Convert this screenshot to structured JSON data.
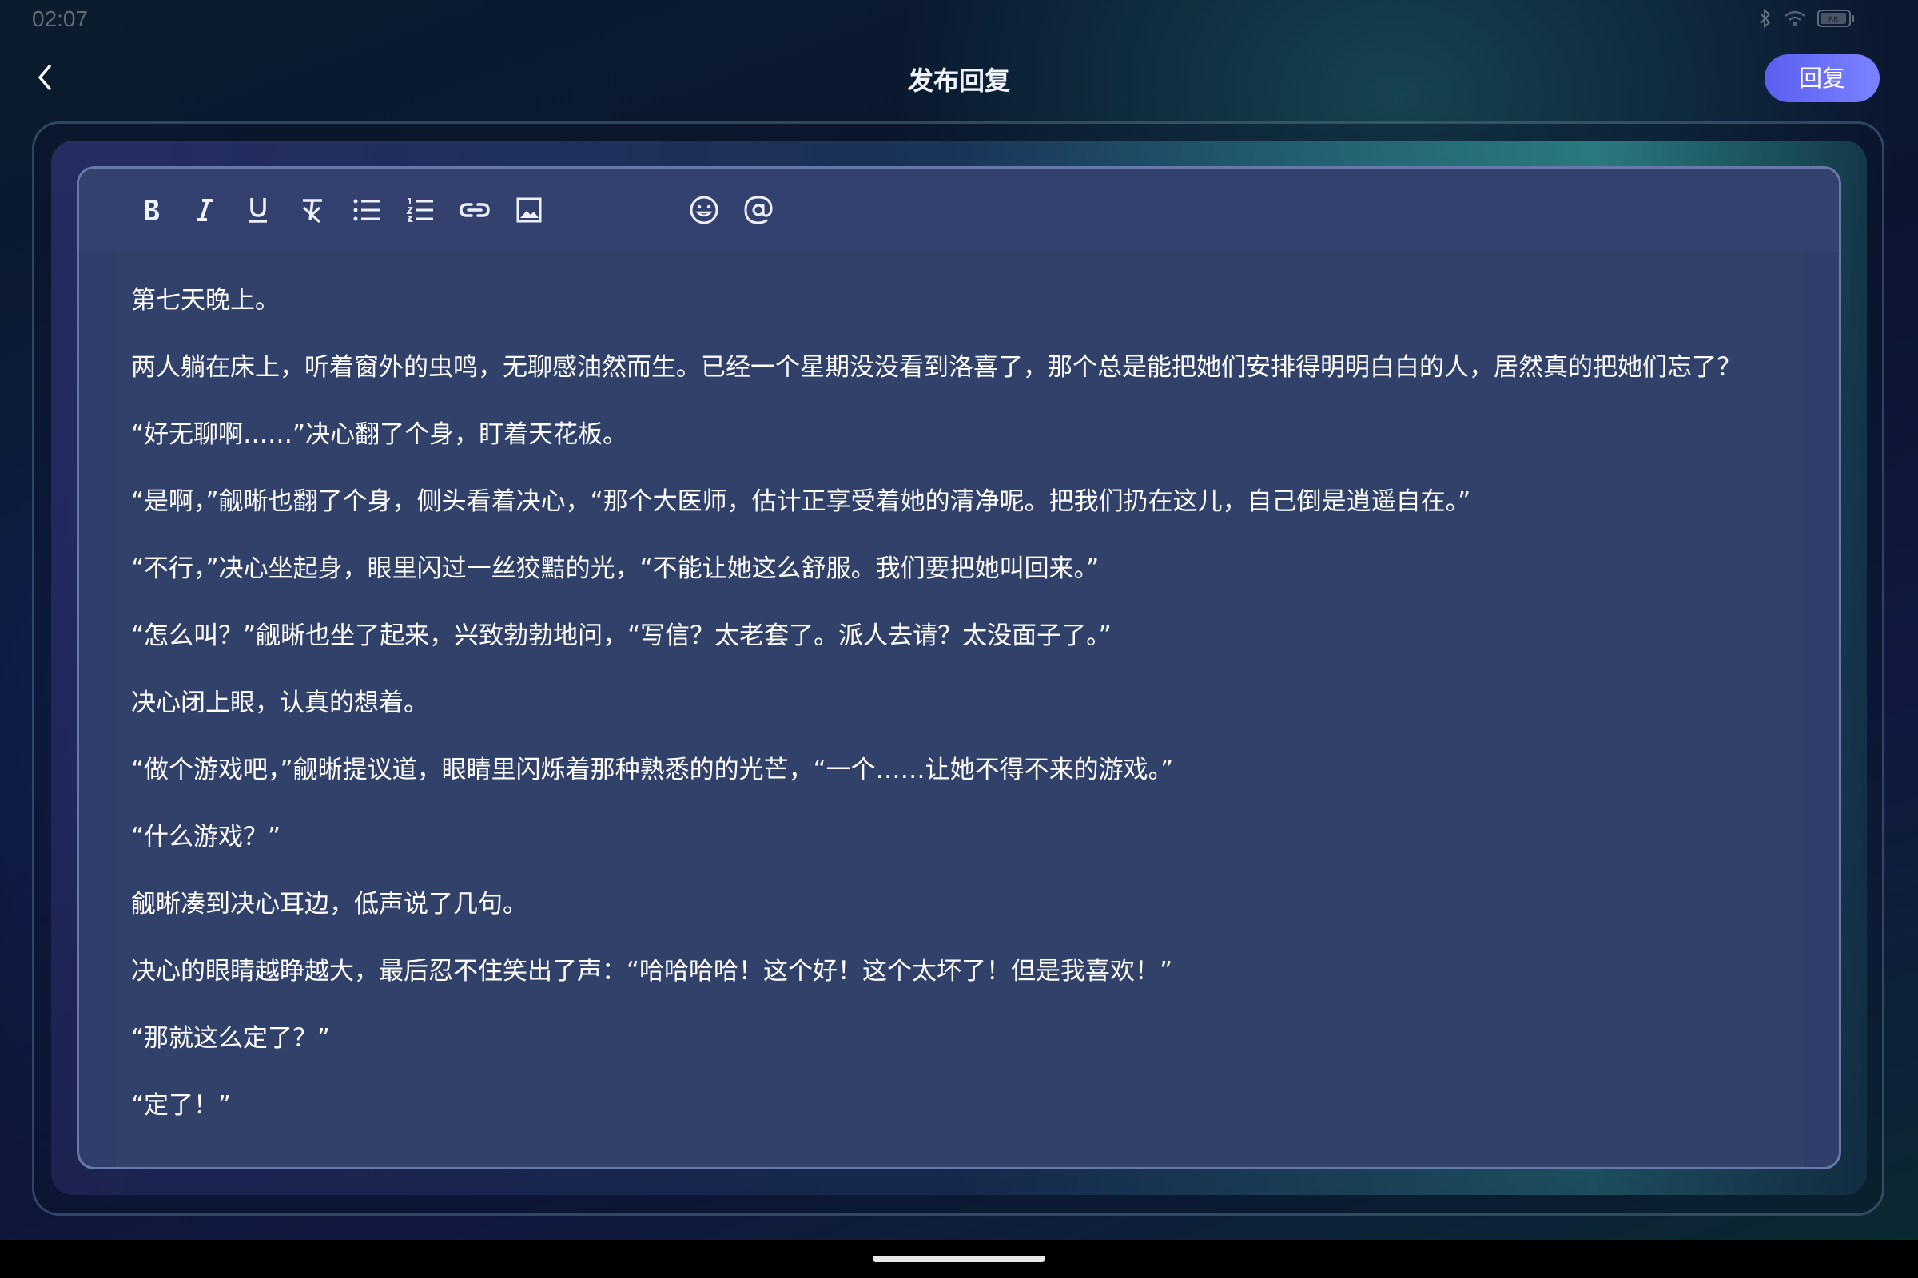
{
  "status_bar": {
    "time": "02:07",
    "battery": "88"
  },
  "header": {
    "title": "发布回复",
    "reply_button": "回复"
  },
  "toolbar": {
    "tools": [
      "bold-icon",
      "italic-icon",
      "underline-icon",
      "clear-format-icon",
      "bullet-list-icon",
      "numbered-list-icon",
      "link-icon",
      "image-icon",
      "emoji-icon",
      "mention-icon"
    ]
  },
  "editor": {
    "paragraphs": [
      "第七天晚上。",
      "两人躺在床上，听着窗外的虫鸣，无聊感油然而生。已经一个星期没没看到洛喜了，那个总是能把她们安排得明明白白的人，居然真的把她们忘了？",
      "“好无聊啊……”决心翻了个身，盯着天花板。",
      "“是啊，”觎晰也翻了个身，侧头看着决心，“那个大医师，估计正享受着她的清净呢。把我们扔在这儿，自己倒是逍遥自在。”",
      "“不行，”决心坐起身，眼里闪过一丝狡黠的光，“不能让她这么舒服。我们要把她叫回来。”",
      "“怎么叫？”觎晰也坐了起来，兴致勃勃地问，“写信？太老套了。派人去请？太没面子了。”",
      "决心闭上眼，认真的想着。",
      "“做个游戏吧，”觎晰提议道，眼睛里闪烁着那种熟悉的的光芒，“一个……让她不得不来的游戏。”",
      "“什么游戏？”",
      "觎晰凑到决心耳边，低声说了几句。",
      "决心的眼睛越睁越大，最后忍不住笑出了声：“哈哈哈哈！这个好！这个太坏了！但是我喜欢！”",
      "“那就这么定了？”",
      "“定了！”"
    ]
  },
  "colors": {
    "accent": "#6a70f8",
    "editor_bg": "#324169",
    "background": "#0b1530"
  }
}
